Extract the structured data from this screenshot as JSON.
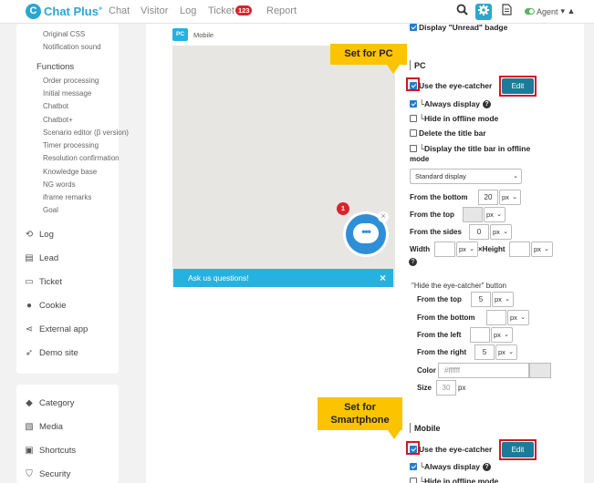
{
  "topbar": {
    "logo_mark": "C",
    "logo_text": "Chat Plus",
    "logo_sup": "+",
    "nav": [
      "Chat",
      "Visitor",
      "Log",
      "Ticket",
      "Report"
    ],
    "ticket_badge": "123",
    "agent_label": "Agent",
    "warn": "▾ ▲"
  },
  "sidebar": {
    "sub_top": [
      "Original CSS",
      "Notification sound"
    ],
    "functions_head": "Functions",
    "functions": [
      "Order processing",
      "Initial message",
      "Chatbot",
      "Chatbot+",
      "Scenario editor (β version)",
      "Timer processing",
      "Resolution confirmation",
      "Knowledge base",
      "NG words",
      "iframe remarks",
      "Goal"
    ],
    "items": [
      "Log",
      "Lead",
      "Ticket",
      "Cookie",
      "External app",
      "Demo site"
    ],
    "items2": [
      "Category",
      "Media",
      "Shortcuts",
      "Security"
    ]
  },
  "preview": {
    "tag_pc": "PC",
    "tag_label": "Mobile",
    "badge": "1",
    "bubble": "•••",
    "close": "×",
    "ask": "Ask us questions!"
  },
  "settings": {
    "unread": "Display \"Unread\" badge",
    "pc_title": "PC",
    "use_eye": "Use the eye-catcher",
    "edit": "Edit",
    "always": "└Always display",
    "hide_offline": "└Hide in offline mode",
    "delete_title": "Delete the title bar",
    "display_title_1": "└Display the title bar in offline",
    "display_title_2": "mode",
    "display_select": "Standard display",
    "from_bottom": "From the bottom",
    "from_bottom_val": "20",
    "from_top": "From the top",
    "from_sides": "From the sides",
    "from_sides_val": "0",
    "px": "px",
    "width": "Width",
    "x_height": "×Height",
    "hide_btn_title": "\"Hide the eye-catcher\" button",
    "hb_top": "From the top",
    "hb_top_val": "5",
    "hb_bottom": "From the bottom",
    "hb_left": "From the left",
    "hb_right": "From the right",
    "hb_right_val": "5",
    "color": "Color",
    "color_val": "#ffffff",
    "size": "Size",
    "size_val": "30",
    "mobile_title": "Mobile",
    "callout_pc": "Set for PC",
    "callout_sp_1": "Set for",
    "callout_sp_2": "Smartphone",
    "q": "?"
  }
}
